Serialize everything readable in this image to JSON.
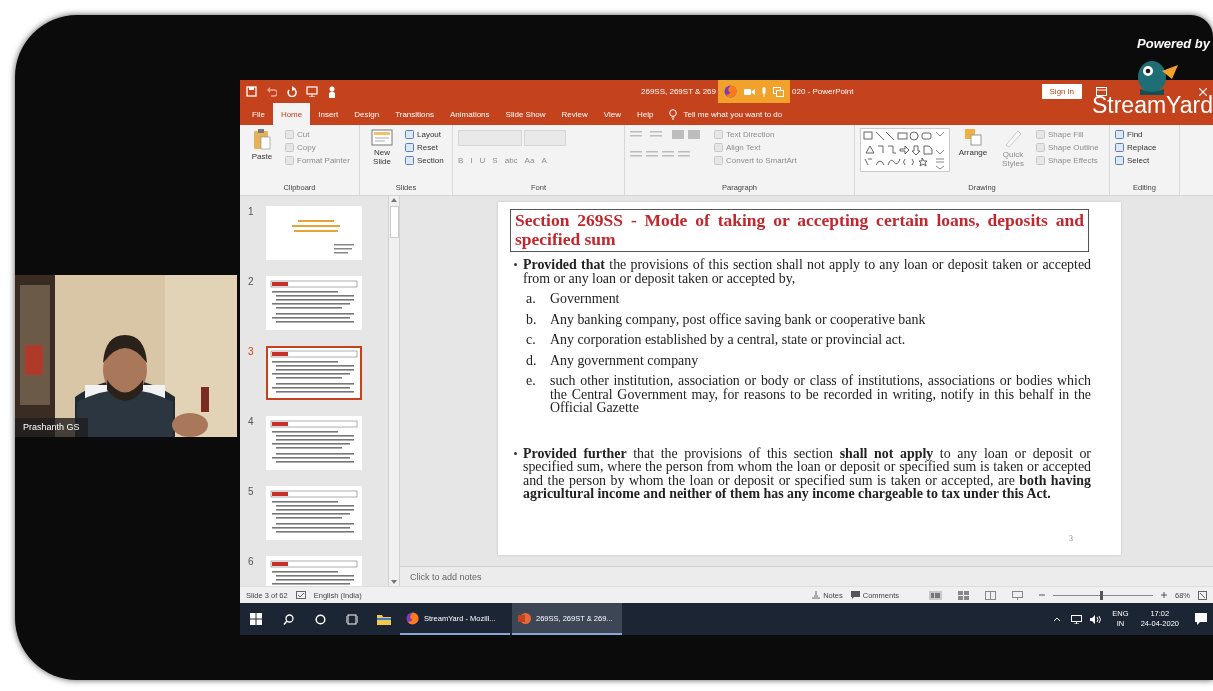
{
  "brand": {
    "powered_by": "Powered by",
    "logo": "StreamYard"
  },
  "camera": {
    "name": "Prashanth GS"
  },
  "window": {
    "title_left": "269SS, 269ST & 269",
    "title_right": "020 - PowerPoint",
    "sign_in": "Sign in"
  },
  "ribbon_tabs": [
    {
      "label": "File",
      "selected": false
    },
    {
      "label": "Home",
      "selected": true
    },
    {
      "label": "Insert",
      "selected": false
    },
    {
      "label": "Design",
      "selected": false
    },
    {
      "label": "Transitions",
      "selected": false
    },
    {
      "label": "Animations",
      "selected": false
    },
    {
      "label": "Slide Show",
      "selected": false
    },
    {
      "label": "Review",
      "selected": false
    },
    {
      "label": "View",
      "selected": false
    },
    {
      "label": "Help",
      "selected": false
    }
  ],
  "tell_me": "Tell me what you want to do",
  "ribbon_groups": [
    {
      "label": "Clipboard",
      "items": [
        {
          "kind": "large",
          "label": "Paste",
          "disabled": false
        },
        {
          "kind": "small",
          "label": "Cut",
          "disabled": true
        },
        {
          "kind": "small",
          "label": "Copy",
          "disabled": true
        },
        {
          "kind": "small",
          "label": "Format Painter",
          "disabled": true
        }
      ]
    },
    {
      "label": "Slides",
      "items": [
        {
          "kind": "large",
          "label": "New Slide",
          "disabled": false
        },
        {
          "kind": "small",
          "label": "Layout",
          "disabled": false
        },
        {
          "kind": "small",
          "label": "Reset",
          "disabled": false
        },
        {
          "kind": "small",
          "label": "Section",
          "disabled": false
        }
      ]
    },
    {
      "label": "Font",
      "items": [
        {
          "kind": "font-boxes",
          "disabled": true
        },
        {
          "kind": "format",
          "labels": [
            "B",
            "I",
            "U",
            "S",
            "abc",
            "Aa",
            "A"
          ],
          "disabled": true
        }
      ]
    },
    {
      "label": "Paragraph",
      "items": [
        {
          "kind": "list-icons",
          "disabled": true
        },
        {
          "kind": "small",
          "label": "Text Direction",
          "disabled": true
        },
        {
          "kind": "small",
          "label": "Align Text",
          "disabled": true
        },
        {
          "kind": "small",
          "label": "Convert to SmartArt",
          "disabled": true
        }
      ]
    },
    {
      "label": "Drawing",
      "items": [
        {
          "kind": "shape-gallery",
          "disabled": false
        },
        {
          "kind": "large",
          "label": "Arrange",
          "disabled": false
        },
        {
          "kind": "large",
          "label": "Quick Styles",
          "disabled": true
        },
        {
          "kind": "small",
          "label": "Shape Fill",
          "disabled": true
        },
        {
          "kind": "small",
          "label": "Shape Outline",
          "disabled": true
        },
        {
          "kind": "small",
          "label": "Shape Effects",
          "disabled": true
        }
      ]
    },
    {
      "label": "Editing",
      "items": [
        {
          "kind": "small",
          "label": "Find",
          "disabled": false
        },
        {
          "kind": "small",
          "label": "Replace",
          "disabled": false
        },
        {
          "kind": "small",
          "label": "Select",
          "disabled": false
        }
      ]
    }
  ],
  "thumbnails": [
    {
      "number": "1",
      "kind": "title",
      "selected": false
    },
    {
      "number": "2",
      "kind": "content",
      "selected": false
    },
    {
      "number": "3",
      "kind": "content",
      "selected": true
    },
    {
      "number": "4",
      "kind": "content",
      "selected": false
    },
    {
      "number": "5",
      "kind": "content",
      "selected": false
    },
    {
      "number": "6",
      "kind": "content",
      "selected": false
    }
  ],
  "slide": {
    "title": "Section 269SS - Mode of taking or accepting certain loans, deposits and specified sum",
    "bullets": [
      {
        "text": "**Provided that** the provisions of this section shall not apply to any loan or deposit taken or accepted from or any loan or deposit taken or accepted by,",
        "items": [
          {
            "marker": "a.",
            "text": "Government"
          },
          {
            "marker": "b.",
            "text": "Any banking company, post office saving bank or cooperative bank"
          },
          {
            "marker": "c.",
            "text": "Any corporation established by a central, state or provincial act."
          },
          {
            "marker": "d.",
            "text": "Any government company"
          },
          {
            "marker": "e.",
            "text": "such other institution, association or body or class of institutions, associations or bodies which the Central Government may, for reasons to be recorded in writing, notify in this behalf in the Official Gazette"
          }
        ]
      },
      {
        "text": "**Provided further** that the provisions of this section **shall not apply** to any loan or deposit or specified sum, where the person from whom the loan or deposit or specified sum is taken or accepted and the person by whom the loan or deposit or specified sum is taken or accepted, are **both having agricultural income and neither of them has any income chargeable to tax under this Act.**"
      }
    ],
    "page_number": "3"
  },
  "notes_placeholder": "Click to add notes",
  "status_bar": {
    "slide": "Slide 3 of 62",
    "language": "English (India)",
    "notes": "Notes",
    "comments": "Comments",
    "zoom": "68%",
    "zoom_slider": {
      "level": 0.48
    }
  },
  "taskbar": {
    "apps": [
      {
        "label": "StreamYard - Mozill...",
        "kind": "browser",
        "selected": false
      },
      {
        "label": "269SS, 269ST & 269...",
        "kind": "slides",
        "selected": true
      }
    ],
    "language": "ENG",
    "region": "IN",
    "time": "17:02",
    "date": "24-04-2020"
  }
}
